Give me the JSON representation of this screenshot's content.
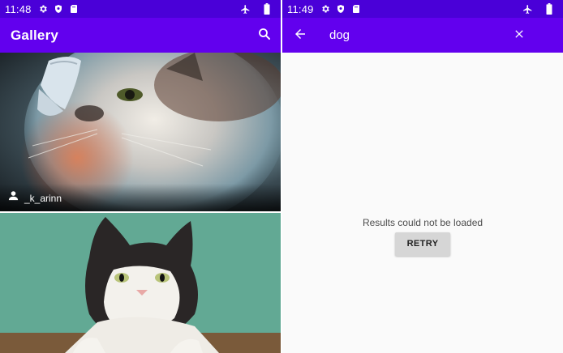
{
  "left_screen": {
    "status_bar": {
      "time": "11:48"
    },
    "app_bar": {
      "title": "Gallery"
    },
    "photos": [
      {
        "username": "_k_arinn"
      }
    ]
  },
  "right_screen": {
    "status_bar": {
      "time": "11:49"
    },
    "search": {
      "query": "dog"
    },
    "error": {
      "message": "Results could not be loaded",
      "retry_label": "RETRY"
    }
  },
  "colors": {
    "status_bar": "#4a00d8",
    "app_bar": "#6200ee",
    "background": "#fafafa"
  },
  "icons": [
    "gear-icon",
    "shield-icon",
    "sd-card-icon",
    "airplane-mode-icon",
    "battery-icon",
    "search-icon",
    "back-arrow-icon",
    "close-icon",
    "person-icon"
  ]
}
